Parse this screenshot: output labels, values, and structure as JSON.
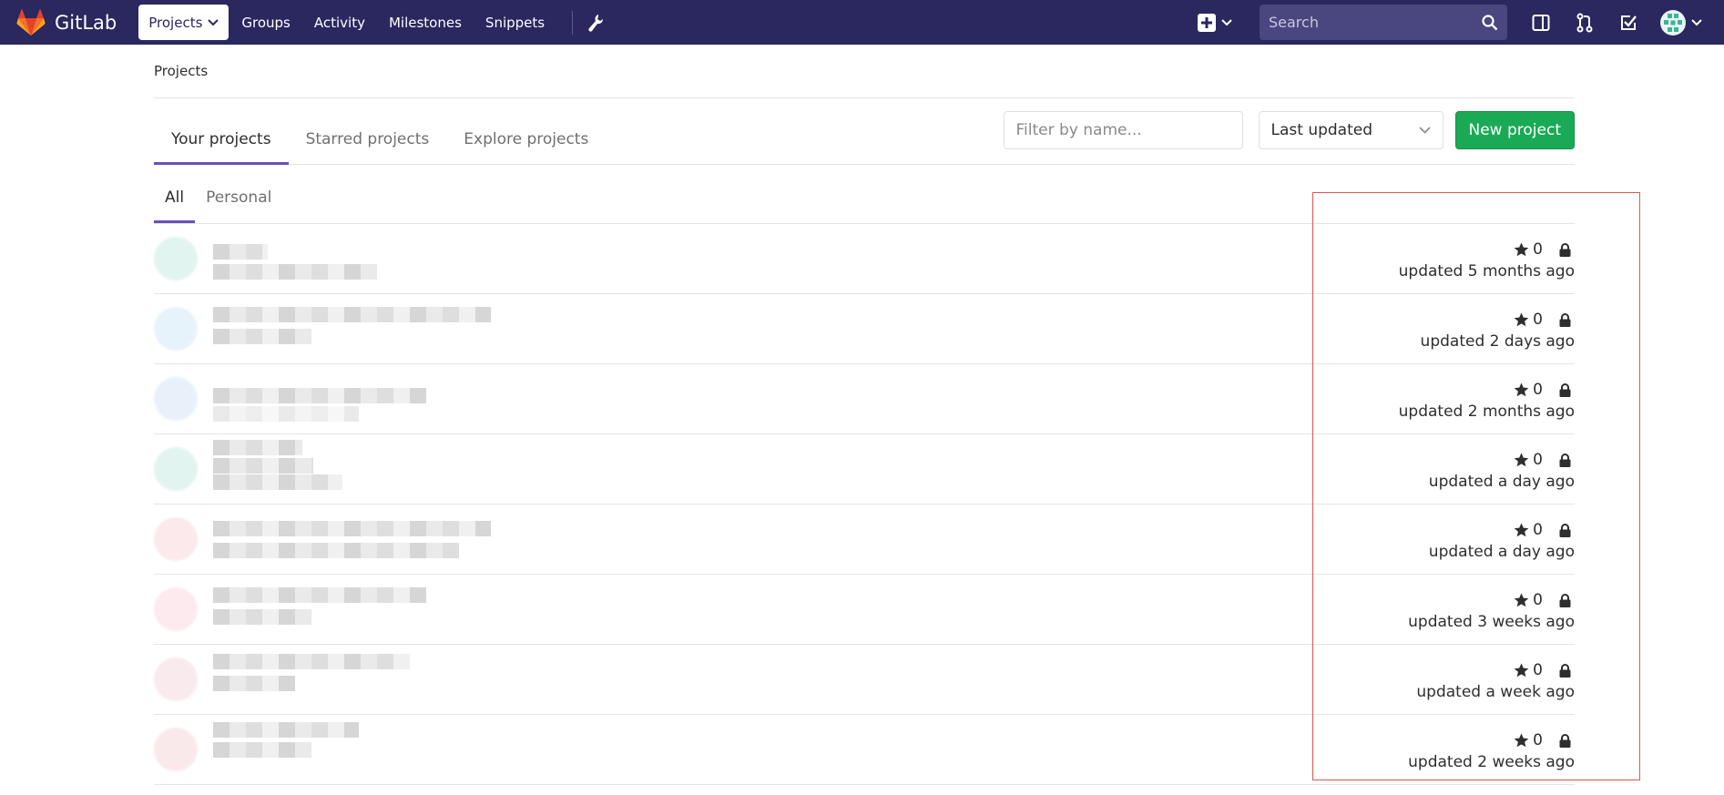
{
  "navbar": {
    "brand": "GitLab",
    "links": [
      {
        "label": "Projects",
        "active": true
      },
      {
        "label": "Groups",
        "active": false
      },
      {
        "label": "Activity",
        "active": false
      },
      {
        "label": "Milestones",
        "active": false
      },
      {
        "label": "Snippets",
        "active": false
      }
    ],
    "search_placeholder": "Search",
    "background": "#2b275f"
  },
  "breadcrumb": "Projects",
  "tabs": [
    {
      "label": "Your projects",
      "active": true
    },
    {
      "label": "Starred projects",
      "active": false
    },
    {
      "label": "Explore projects",
      "active": false
    }
  ],
  "filter": {
    "placeholder": "Filter by name..."
  },
  "sort": {
    "selected": "Last updated"
  },
  "new_project_label": "New project",
  "sub_tabs": [
    {
      "label": "All",
      "active": true
    },
    {
      "label": "Personal",
      "active": false
    }
  ],
  "projects": [
    {
      "stars": "0",
      "updated": "updated 5 months ago",
      "visibility": "private"
    },
    {
      "stars": "0",
      "updated": "updated 2 days ago",
      "visibility": "private"
    },
    {
      "stars": "0",
      "updated": "updated 2 months ago",
      "visibility": "private"
    },
    {
      "stars": "0",
      "updated": "updated a day ago",
      "visibility": "private"
    },
    {
      "stars": "0",
      "updated": "updated a day ago",
      "visibility": "private"
    },
    {
      "stars": "0",
      "updated": "updated 3 weeks ago",
      "visibility": "private"
    },
    {
      "stars": "0",
      "updated": "updated a week ago",
      "visibility": "private"
    },
    {
      "stars": "0",
      "updated": "updated 2 weeks ago",
      "visibility": "private"
    }
  ],
  "colors": {
    "accent": "#6b4fbb",
    "success": "#1aaa55",
    "highlight": "#e05353"
  }
}
